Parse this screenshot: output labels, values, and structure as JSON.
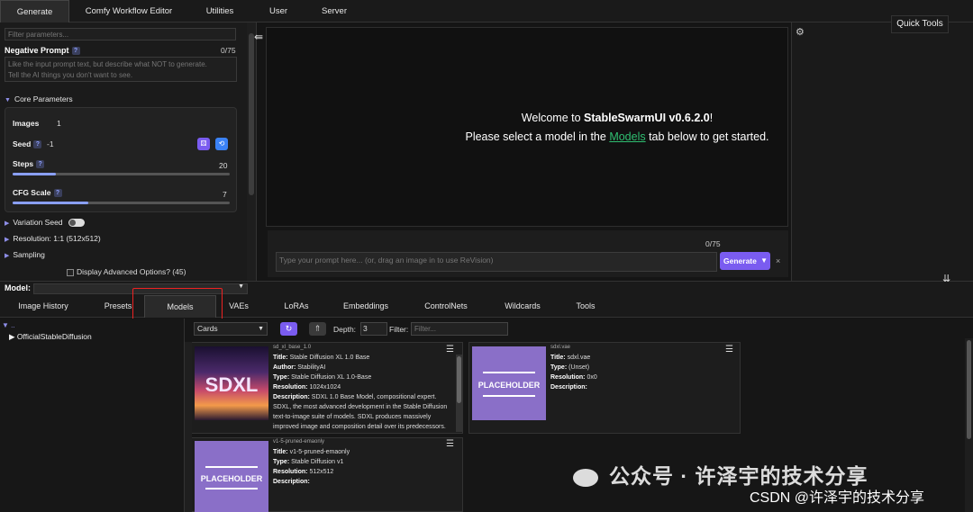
{
  "top_tabs": [
    "Generate",
    "Comfy Workflow Editor",
    "Utilities",
    "User",
    "Server"
  ],
  "quick_tools": "Quick Tools",
  "left_panel": {
    "filter_placeholder": "Filter parameters...",
    "negative_prompt_label": "Negative Prompt",
    "negative_prompt_count": "0/75",
    "negative_prompt_placeholder": "Like the input prompt text, but describe what NOT to generate.\nTell the AI things you don't want to see.",
    "core_params_label": "Core Parameters",
    "images_label": "Images",
    "images_value": "1",
    "seed_label": "Seed",
    "seed_value": "-1",
    "steps_label": "Steps",
    "steps_value": "20",
    "steps_fill": 0.2,
    "cfg_label": "CFG Scale",
    "cfg_value": "7",
    "cfg_fill": 0.35,
    "variation_seed_label": "Variation Seed",
    "resolution_label": "Resolution: 1:1 (512x512)",
    "sampling_label": "Sampling",
    "advanced_label": "Display Advanced Options? (45)"
  },
  "center": {
    "welcome_prefix": "Welcome to ",
    "welcome_app": "StableSwarmUI v0.6.2.0",
    "welcome_suffix": "!",
    "select_prefix": "Please select a model in the ",
    "select_link": "Models",
    "select_suffix": " tab below to get started.",
    "prompt_count": "0/75",
    "prompt_placeholder": "Type your prompt here... (or, drag an image in to use ReVision)",
    "generate_label": "Generate",
    "close_label": "×"
  },
  "model_bar": {
    "label": "Model:"
  },
  "bottom_tabs": [
    "Image History",
    "Presets",
    "Models",
    "VAEs",
    "LoRAs",
    "Embeddings",
    "ControlNets",
    "Wildcards",
    "Tools"
  ],
  "model_browser": {
    "tree_root": "..",
    "tree_item": "OfficialStableDiffusion",
    "view_mode": "Cards",
    "depth_label": "Depth:",
    "depth_value": "3",
    "filter_label": "Filter:",
    "filter_placeholder": "Filter...",
    "cards": [
      {
        "file": "sd_xl_base_1.0",
        "thumb_text": "SDXL",
        "lines": [
          {
            "k": "Title:",
            "v": "Stable Diffusion XL 1.0 Base"
          },
          {
            "k": "Author:",
            "v": "StabilityAI"
          },
          {
            "k": "Type:",
            "v": "Stable Diffusion XL 1.0-Base"
          },
          {
            "k": "Resolution:",
            "v": "1024x1024"
          }
        ],
        "description_label": "Description:",
        "description": "SDXL 1.0 Base Model, compositional expert. SDXL, the most advanced development in the Stable Diffusion text-to-image suite of models. SDXL produces massively improved image and composition detail over its predecessors. The ability to generate hyper-realistic creations for films, television, music, and in"
      },
      {
        "file": "sdxl.vae",
        "thumb_text": "PLACEHOLDER",
        "lines": [
          {
            "k": "Title:",
            "v": "sdxl.vae"
          },
          {
            "k": "Type:",
            "v": "(Unset)"
          },
          {
            "k": "Resolution:",
            "v": "0x0"
          }
        ],
        "description_label": "Description:",
        "description": ""
      },
      {
        "file": "v1-5-pruned-emaonly",
        "thumb_text": "PLACEHOLDER",
        "lines": [
          {
            "k": "Title:",
            "v": "v1-5-pruned-emaonly"
          },
          {
            "k": "Type:",
            "v": "Stable Diffusion v1"
          },
          {
            "k": "Resolution:",
            "v": "512x512"
          }
        ],
        "description_label": "Description:",
        "description": ""
      }
    ]
  },
  "watermark": {
    "line1": "公众号 · 许泽宇的技术分享",
    "line2": "CSDN @许泽宇的技术分享"
  }
}
